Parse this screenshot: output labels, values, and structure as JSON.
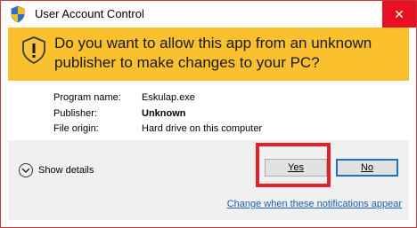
{
  "window": {
    "title": "User Account Control",
    "close_symbol": "✕"
  },
  "banner": {
    "question": "Do you want to allow this app from an unknown publisher to make changes to your PC?",
    "icon": "shield-icon",
    "color": "#fbc02d"
  },
  "info": {
    "program_name_label": "Program name:",
    "program_name_value": "Eskulap.exe",
    "publisher_label": "Publisher:",
    "publisher_value": "Unknown",
    "file_origin_label": "File origin:",
    "file_origin_value": "Hard drive on this computer"
  },
  "footer": {
    "show_details_label": "Show details",
    "yes_label": "Yes",
    "no_label": "No",
    "notifications_link": "Change when these notifications appear"
  },
  "colors": {
    "accent": "#e0202a",
    "link": "#1a5fb4",
    "close_bg": "#e81123"
  }
}
